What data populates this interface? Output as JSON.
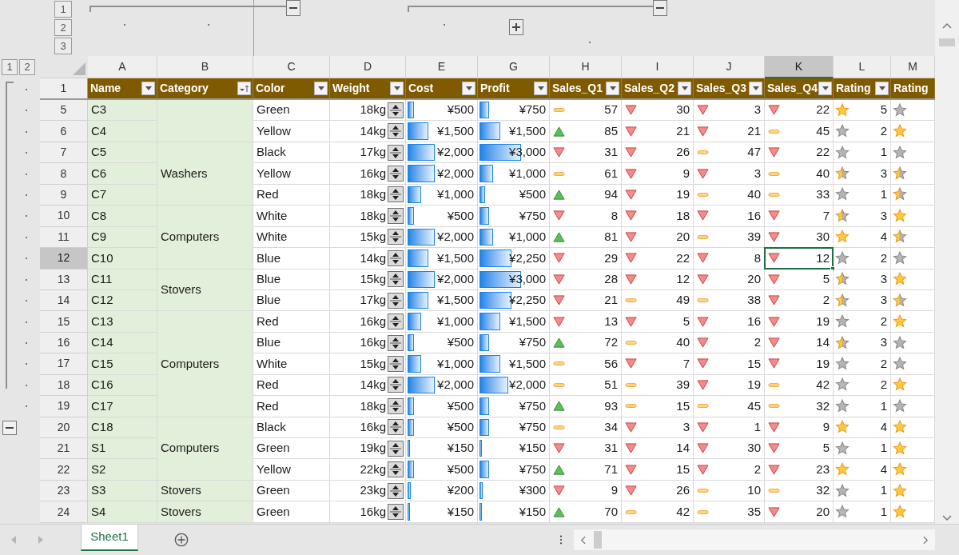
{
  "column_outline": {
    "levels": [
      "1",
      "2",
      "3"
    ],
    "groups": [
      {
        "expanded": true
      },
      {
        "expanded": true
      },
      {
        "expanded": false
      }
    ]
  },
  "row_outline": {
    "levels": [
      "1",
      "2"
    ]
  },
  "columns": [
    {
      "letter": "A",
      "selected": false
    },
    {
      "letter": "B",
      "selected": false
    },
    {
      "letter": "C",
      "selected": false
    },
    {
      "letter": "D",
      "selected": false
    },
    {
      "letter": "E",
      "selected": false
    },
    {
      "letter": "G",
      "selected": false
    },
    {
      "letter": "H",
      "selected": false
    },
    {
      "letter": "I",
      "selected": false
    },
    {
      "letter": "J",
      "selected": false
    },
    {
      "letter": "K",
      "selected": true
    },
    {
      "letter": "L",
      "selected": false
    },
    {
      "letter": "M",
      "selected": false
    }
  ],
  "header_row": {
    "number": "1",
    "outline": {
      "kind": "dot"
    },
    "cells": [
      {
        "label": "Name",
        "kind": "dropdown"
      },
      {
        "label": "Category",
        "kind": "sorted"
      },
      {
        "label": "Color",
        "kind": "dropdown"
      },
      {
        "label": "Weight",
        "kind": "dropdown"
      },
      {
        "label": "Cost",
        "kind": "dropdown"
      },
      {
        "label": "Profit",
        "kind": "dropdown"
      },
      {
        "label": "Sales_Q1",
        "kind": "dropdown"
      },
      {
        "label": "Sales_Q2",
        "kind": "dropdown"
      },
      {
        "label": "Sales_Q3",
        "kind": "dropdown"
      },
      {
        "label": "Sales_Q4",
        "kind": "dropdown"
      },
      {
        "label": "Rating",
        "kind": "dropdown"
      },
      {
        "label": "Rating"
      }
    ]
  },
  "groups": [
    {
      "rows": [
        {
          "number": "5",
          "outline": {
            "kind": "dot"
          },
          "selected": false,
          "name": "C3",
          "color_name": "Green",
          "weight": "18kg",
          "cost": {
            "text": "¥500",
            "level": 0.09
          },
          "profit": {
            "text": "¥750",
            "level": 0.13
          },
          "sales": [
            {
              "value": "57",
              "kind": "flat"
            },
            {
              "value": "30",
              "kind": "down"
            },
            {
              "value": "3",
              "kind": "down"
            },
            {
              "value": "22",
              "kind": "down"
            }
          ],
          "rating": {
            "value": "5",
            "kind": "full"
          },
          "rating_2": {
            "kind": "empty"
          }
        },
        {
          "number": "6",
          "outline": {
            "kind": "dot"
          },
          "selected": false,
          "name": "C4",
          "color_name": "Yellow",
          "weight": "14kg",
          "cost": {
            "text": "¥1,500",
            "level": 0.29
          },
          "profit": {
            "text": "¥1,500",
            "level": 0.29
          },
          "sales": [
            {
              "value": "85",
              "kind": "up"
            },
            {
              "value": "21",
              "kind": "down"
            },
            {
              "value": "21",
              "kind": "down"
            },
            {
              "value": "45",
              "kind": "flat"
            }
          ],
          "rating": {
            "value": "2",
            "kind": "empty"
          },
          "rating_2": {
            "kind": "full"
          }
        }
      ]
    },
    {
      "category": "Washers",
      "rows": [
        {
          "number": "7",
          "outline": {
            "kind": "dot"
          },
          "selected": false,
          "name": "C5",
          "color_name": "Black",
          "weight": "17kg",
          "cost": {
            "text": "¥2,000",
            "level": 0.38
          },
          "profit": {
            "text": "¥3,000",
            "level": 0.58
          },
          "sales": [
            {
              "value": "31",
              "kind": "down"
            },
            {
              "value": "26",
              "kind": "down"
            },
            {
              "value": "47",
              "kind": "flat"
            },
            {
              "value": "22",
              "kind": "down"
            }
          ],
          "rating": {
            "value": "1",
            "kind": "empty"
          },
          "rating_2": {
            "kind": "empty"
          }
        },
        {
          "number": "8",
          "outline": {
            "kind": "dot"
          },
          "selected": false,
          "name": "C6",
          "color_name": "Yellow",
          "weight": "16kg",
          "cost": {
            "text": "¥2,000",
            "level": 0.38
          },
          "profit": {
            "text": "¥1,000",
            "level": 0.19
          },
          "sales": [
            {
              "value": "61",
              "kind": "flat"
            },
            {
              "value": "9",
              "kind": "down"
            },
            {
              "value": "3",
              "kind": "down"
            },
            {
              "value": "40",
              "kind": "flat"
            }
          ],
          "rating": {
            "value": "3",
            "kind": "half"
          },
          "rating_2": {
            "kind": "half"
          }
        },
        {
          "number": "9",
          "outline": {
            "kind": "dot"
          },
          "selected": false,
          "name": "C7",
          "color_name": "Red",
          "weight": "18kg",
          "cost": {
            "text": "¥1,000",
            "level": 0.19
          },
          "profit": {
            "text": "¥500",
            "level": 0.08
          },
          "sales": [
            {
              "value": "94",
              "kind": "up"
            },
            {
              "value": "19",
              "kind": "down"
            },
            {
              "value": "40",
              "kind": "flat"
            },
            {
              "value": "33",
              "kind": "flat"
            }
          ],
          "rating": {
            "value": "1",
            "kind": "empty"
          },
          "rating_2": {
            "kind": "half"
          }
        }
      ]
    },
    {
      "category": "Computers",
      "rows": [
        {
          "number": "10",
          "outline": {
            "kind": "dot"
          },
          "selected": false,
          "name": "C8",
          "color_name": "White",
          "weight": "18kg",
          "cost": {
            "text": "¥500",
            "level": 0.09
          },
          "profit": {
            "text": "¥750",
            "level": 0.13
          },
          "sales": [
            {
              "value": "8",
              "kind": "down"
            },
            {
              "value": "18",
              "kind": "down"
            },
            {
              "value": "16",
              "kind": "down"
            },
            {
              "value": "7",
              "kind": "down"
            }
          ],
          "rating": {
            "value": "3",
            "kind": "half"
          },
          "rating_2": {
            "kind": "full"
          }
        },
        {
          "number": "11",
          "outline": {
            "kind": "dot"
          },
          "selected": false,
          "name": "C9",
          "color_name": "White",
          "weight": "15kg",
          "cost": {
            "text": "¥2,000",
            "level": 0.38
          },
          "profit": {
            "text": "¥1,000",
            "level": 0.19
          },
          "sales": [
            {
              "value": "81",
              "kind": "up"
            },
            {
              "value": "20",
              "kind": "down"
            },
            {
              "value": "39",
              "kind": "flat"
            },
            {
              "value": "30",
              "kind": "down"
            }
          ],
          "rating": {
            "value": "4",
            "kind": "full"
          },
          "rating_2": {
            "kind": "half"
          }
        },
        {
          "number": "12",
          "outline": {
            "kind": "dot"
          },
          "selected": true,
          "name": "C10",
          "color_name": "Blue",
          "weight": "14kg",
          "cost": {
            "text": "¥1,500",
            "level": 0.29
          },
          "profit": {
            "text": "¥2,250",
            "level": 0.45
          },
          "sales": [
            {
              "value": "29",
              "kind": "down"
            },
            {
              "value": "22",
              "kind": "down"
            },
            {
              "value": "8",
              "kind": "down"
            },
            {
              "value": "12",
              "kind": "down"
            }
          ],
          "rating": {
            "value": "2",
            "kind": "empty"
          },
          "rating_2": {
            "kind": "empty"
          }
        }
      ]
    },
    {
      "category": "Stovers",
      "rows": [
        {
          "number": "13",
          "outline": {
            "kind": "dot"
          },
          "selected": false,
          "name": "C11",
          "color_name": "Blue",
          "weight": "15kg",
          "cost": {
            "text": "¥2,000",
            "level": 0.38
          },
          "profit": {
            "text": "¥3,000",
            "level": 0.58
          },
          "sales": [
            {
              "value": "28",
              "kind": "down"
            },
            {
              "value": "12",
              "kind": "down"
            },
            {
              "value": "20",
              "kind": "down"
            },
            {
              "value": "5",
              "kind": "down"
            }
          ],
          "rating": {
            "value": "3",
            "kind": "half"
          },
          "rating_2": {
            "kind": "full"
          }
        },
        {
          "number": "14",
          "outline": {
            "kind": "dot"
          },
          "selected": false,
          "name": "C12",
          "color_name": "Blue",
          "weight": "17kg",
          "cost": {
            "text": "¥1,500",
            "level": 0.29
          },
          "profit": {
            "text": "¥2,250",
            "level": 0.45
          },
          "sales": [
            {
              "value": "21",
              "kind": "down"
            },
            {
              "value": "49",
              "kind": "flat"
            },
            {
              "value": "38",
              "kind": "flat"
            },
            {
              "value": "2",
              "kind": "down"
            }
          ],
          "rating": {
            "value": "3",
            "kind": "half"
          },
          "rating_2": {
            "kind": "half"
          }
        }
      ]
    },
    {
      "category": "Computers",
      "rows": [
        {
          "number": "15",
          "outline": {
            "kind": "dot"
          },
          "selected": false,
          "name": "C13",
          "color_name": "Red",
          "weight": "16kg",
          "cost": {
            "text": "¥1,000",
            "level": 0.19
          },
          "profit": {
            "text": "¥1,500",
            "level": 0.29
          },
          "sales": [
            {
              "value": "13",
              "kind": "down"
            },
            {
              "value": "5",
              "kind": "down"
            },
            {
              "value": "16",
              "kind": "down"
            },
            {
              "value": "19",
              "kind": "down"
            }
          ],
          "rating": {
            "value": "2",
            "kind": "empty"
          },
          "rating_2": {
            "kind": "full"
          }
        },
        {
          "number": "16",
          "outline": {
            "kind": "dot"
          },
          "selected": false,
          "name": "C14",
          "color_name": "Blue",
          "weight": "16kg",
          "cost": {
            "text": "¥500",
            "level": 0.09
          },
          "profit": {
            "text": "¥750",
            "level": 0.13
          },
          "sales": [
            {
              "value": "72",
              "kind": "up"
            },
            {
              "value": "40",
              "kind": "flat"
            },
            {
              "value": "2",
              "kind": "down"
            },
            {
              "value": "14",
              "kind": "down"
            }
          ],
          "rating": {
            "value": "3",
            "kind": "half"
          },
          "rating_2": {
            "kind": "empty"
          }
        },
        {
          "number": "17",
          "outline": {
            "kind": "dot"
          },
          "selected": false,
          "name": "C15",
          "color_name": "White",
          "weight": "15kg",
          "cost": {
            "text": "¥1,000",
            "level": 0.19
          },
          "profit": {
            "text": "¥1,500",
            "level": 0.29
          },
          "sales": [
            {
              "value": "56",
              "kind": "flat"
            },
            {
              "value": "7",
              "kind": "down"
            },
            {
              "value": "15",
              "kind": "down"
            },
            {
              "value": "19",
              "kind": "down"
            }
          ],
          "rating": {
            "value": "2",
            "kind": "empty"
          },
          "rating_2": {
            "kind": "empty"
          }
        },
        {
          "number": "18",
          "outline": {
            "kind": "dot"
          },
          "selected": false,
          "name": "C16",
          "color_name": "Red",
          "weight": "14kg",
          "cost": {
            "text": "¥2,000",
            "level": 0.38
          },
          "profit": {
            "text": "¥2,000",
            "level": 0.41
          },
          "sales": [
            {
              "value": "51",
              "kind": "flat"
            },
            {
              "value": "39",
              "kind": "flat"
            },
            {
              "value": "19",
              "kind": "down"
            },
            {
              "value": "42",
              "kind": "flat"
            }
          ],
          "rating": {
            "value": "2",
            "kind": "empty"
          },
          "rating_2": {
            "kind": "full"
          }
        },
        {
          "number": "19",
          "outline": {
            "kind": "dot"
          },
          "selected": false,
          "name": "C17",
          "color_name": "Red",
          "weight": "18kg",
          "cost": {
            "text": "¥500",
            "level": 0.09
          },
          "profit": {
            "text": "¥750",
            "level": 0.13
          },
          "sales": [
            {
              "value": "93",
              "kind": "up"
            },
            {
              "value": "15",
              "kind": "flat"
            },
            {
              "value": "45",
              "kind": "flat"
            },
            {
              "value": "32",
              "kind": "flat"
            }
          ],
          "rating": {
            "value": "1",
            "kind": "empty"
          },
          "rating_2": {
            "kind": "empty"
          }
        }
      ]
    },
    {
      "category": "Computers",
      "rows": [
        {
          "number": "20",
          "outline": {
            "kind": "collapse"
          },
          "selected": false,
          "name": "C18",
          "color_name": "Black",
          "weight": "16kg",
          "cost": {
            "text": "¥500",
            "level": 0.09
          },
          "profit": {
            "text": "¥750",
            "level": 0.13
          },
          "sales": [
            {
              "value": "34",
              "kind": "flat"
            },
            {
              "value": "3",
              "kind": "down"
            },
            {
              "value": "1",
              "kind": "down"
            },
            {
              "value": "9",
              "kind": "down"
            }
          ],
          "rating": {
            "value": "4",
            "kind": "full"
          },
          "rating_2": {
            "kind": "full"
          }
        },
        {
          "number": "21",
          "selected": false,
          "name": "S1",
          "color_name": "Green",
          "weight": "19kg",
          "cost": {
            "text": "¥150",
            "level": 0.03
          },
          "profit": {
            "text": "¥150",
            "level": 0.03
          },
          "sales": [
            {
              "value": "31",
              "kind": "down"
            },
            {
              "value": "14",
              "kind": "down"
            },
            {
              "value": "30",
              "kind": "down"
            },
            {
              "value": "5",
              "kind": "down"
            }
          ],
          "rating": {
            "value": "1",
            "kind": "empty"
          },
          "rating_2": {
            "kind": "full"
          }
        },
        {
          "number": "22",
          "selected": false,
          "name": "S2",
          "color_name": "Yellow",
          "weight": "22kg",
          "cost": {
            "text": "¥500",
            "level": 0.09
          },
          "profit": {
            "text": "¥750",
            "level": 0.13
          },
          "sales": [
            {
              "value": "71",
              "kind": "up"
            },
            {
              "value": "15",
              "kind": "down"
            },
            {
              "value": "2",
              "kind": "down"
            },
            {
              "value": "23",
              "kind": "down"
            }
          ],
          "rating": {
            "value": "4",
            "kind": "full"
          },
          "rating_2": {
            "kind": "full"
          }
        }
      ]
    },
    {
      "category": "Stovers",
      "rows": [
        {
          "number": "23",
          "selected": false,
          "name": "S3",
          "color_name": "Green",
          "weight": "23kg",
          "cost": {
            "text": "¥200",
            "level": 0.05
          },
          "profit": {
            "text": "¥300",
            "level": 0.05
          },
          "sales": [
            {
              "value": "9",
              "kind": "down"
            },
            {
              "value": "26",
              "kind": "down"
            },
            {
              "value": "10",
              "kind": "flat"
            },
            {
              "value": "32",
              "kind": "flat"
            }
          ],
          "rating": {
            "value": "1",
            "kind": "empty"
          },
          "rating_2": {
            "kind": "full"
          }
        }
      ]
    },
    {
      "category": "Stovers",
      "rows": [
        {
          "number": "24",
          "selected": false,
          "name": "S4",
          "color_name": "Green",
          "weight": "16kg",
          "cost": {
            "text": "¥150",
            "level": 0.03
          },
          "profit": {
            "text": "¥150",
            "level": 0.03
          },
          "sales": [
            {
              "value": "70",
              "kind": "up"
            },
            {
              "value": "42",
              "kind": "flat"
            },
            {
              "value": "35",
              "kind": "flat"
            },
            {
              "value": "20",
              "kind": "down"
            }
          ],
          "rating": {
            "value": "1",
            "kind": "empty"
          },
          "rating_2": {
            "kind": "full"
          }
        }
      ]
    }
  ],
  "sheet_tabs": [
    {
      "label": "Sheet1",
      "selected": true
    }
  ]
}
